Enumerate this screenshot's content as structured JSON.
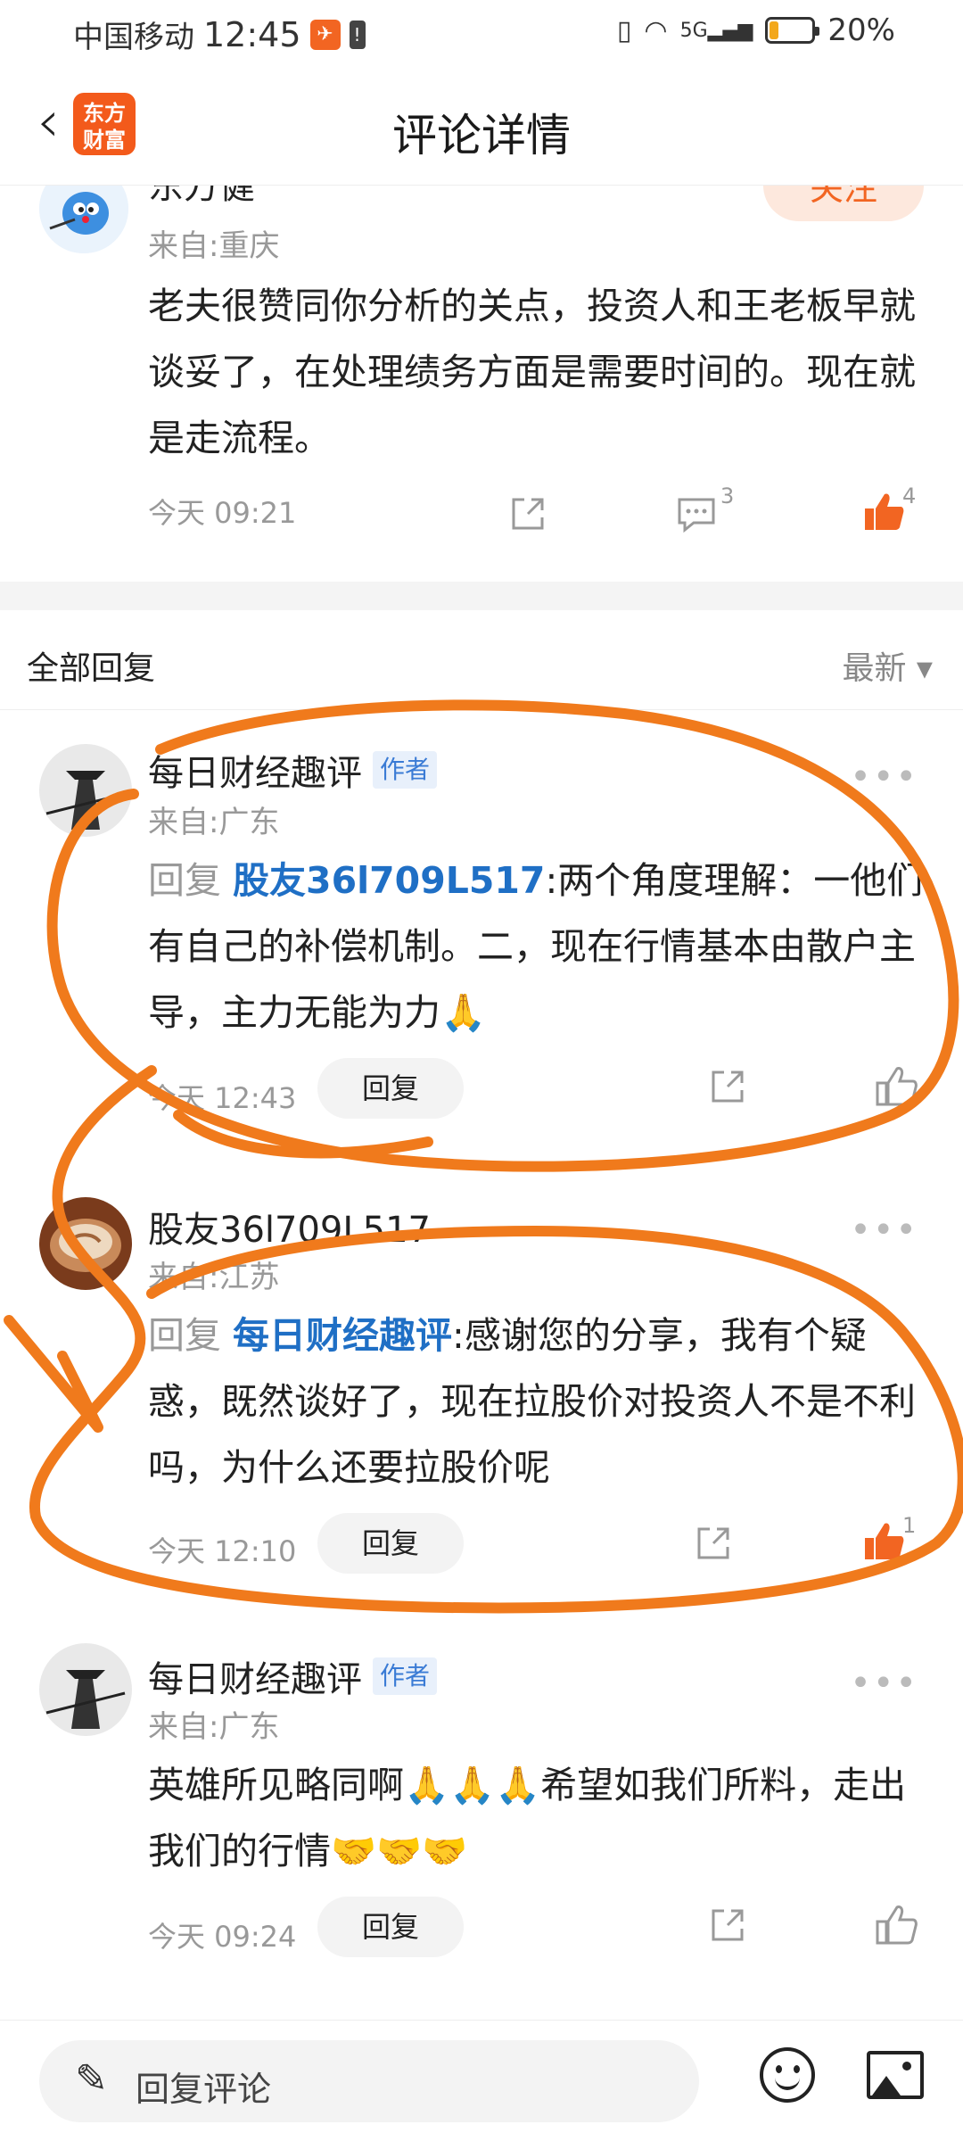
{
  "status_bar": {
    "carrier": "中国移动",
    "time": "12:45",
    "network": "5G",
    "battery_percent": "20%",
    "battery_level": 0.2
  },
  "header": {
    "logo_line1": "东方",
    "logo_line2": "财富",
    "title": "评论详情"
  },
  "main_comment": {
    "name": "东方健",
    "follow_label": "关注",
    "from": "来自:重庆",
    "text": "老夫很赞同你分析的关点，投资人和王老板早就谈妥了，在处理绩务方面是需要时间的。现在就是走流程。",
    "time": "今天 09:21",
    "comment_count": "3",
    "like_count": "4"
  },
  "replies_header": {
    "title": "全部回复",
    "sort_label": "最新 ▾"
  },
  "replies": [
    {
      "name": "每日财经趣评",
      "author_tag": "作者",
      "from": "来自:广东",
      "reply_prefix": "回复",
      "mention": "股友36l709L517",
      "text": ":两个角度理解：一他们有自己的补偿机制。二，现在行情基本由散户主导，主力无能为力🙏",
      "time": "今天 12:43",
      "reply_label": "回复",
      "like_count": ""
    },
    {
      "name": "股友36l709L517",
      "author_tag": "",
      "from": "来自:江苏",
      "reply_prefix": "回复",
      "mention": "每日财经趣评",
      "text": ":感谢您的分享，我有个疑惑，既然谈好了，现在拉股价对投资人不是不利吗，为什么还要拉股价呢",
      "time": "今天 12:10",
      "reply_label": "回复",
      "like_count": "1"
    },
    {
      "name": "每日财经趣评",
      "author_tag": "作者",
      "from": "来自:广东",
      "text": "英雄所见略同啊🙏🙏🙏希望如我们所料，走出我们的行情🤝🤝🤝",
      "time": "今天 09:24",
      "reply_label": "回复",
      "like_count": ""
    }
  ],
  "bottom_bar": {
    "input_placeholder": "回复评论"
  },
  "colors": {
    "accent": "#f26522",
    "mention": "#1f6fc5",
    "scribble": "#f07a1c"
  }
}
